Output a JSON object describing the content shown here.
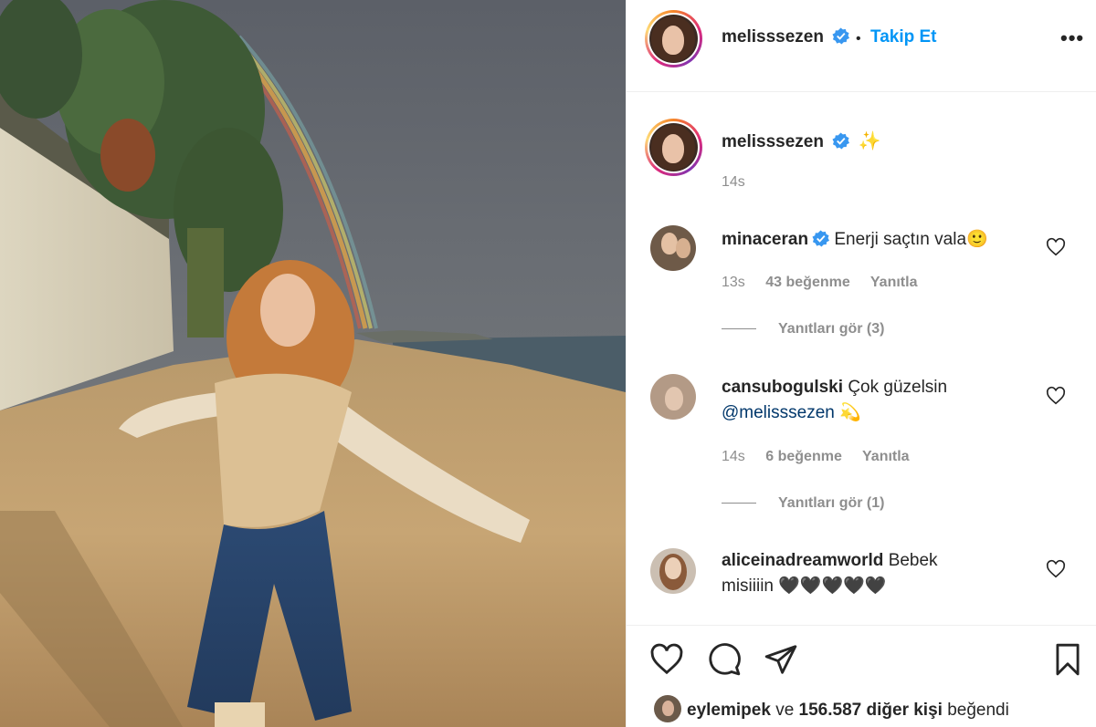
{
  "header": {
    "username": "melisssezen",
    "separator": "•",
    "follow_label": "Takip Et",
    "more_label": "•••"
  },
  "caption": {
    "username": "melisssezen",
    "text": "✨",
    "time": "14s"
  },
  "comments": [
    {
      "username": "minaceran",
      "verified": true,
      "text": "Enerji saçtın vala🙂",
      "time": "13s",
      "likes": "43 beğenme",
      "reply_label": "Yanıtla",
      "view_replies": "Yanıtları gör (3)"
    },
    {
      "username": "cansubogulski",
      "verified": false,
      "text": "Çok güzelsin",
      "mention": "@melisssezen",
      "emoji": "💫",
      "time": "14s",
      "likes": "6 beğenme",
      "reply_label": "Yanıtla",
      "view_replies": "Yanıtları gör (1)"
    },
    {
      "username": "aliceinadreamworld",
      "verified": false,
      "text": "Bebek misiiiin 🖤🖤🖤🖤🖤"
    }
  ],
  "likes_bar": {
    "liker": "eylemipek",
    "connector": "ve",
    "count_text": "156.587 diğer kişi",
    "suffix": "beğendi"
  },
  "icons": {
    "like": "heart-icon",
    "comment": "comment-icon",
    "share": "paper-plane-icon",
    "save": "bookmark-icon",
    "verified": "verified-badge-icon"
  },
  "colors": {
    "link_blue": "#0095f6",
    "verified_blue": "#3897f0",
    "muted_gray": "#8e8e8e",
    "text": "#262626"
  }
}
